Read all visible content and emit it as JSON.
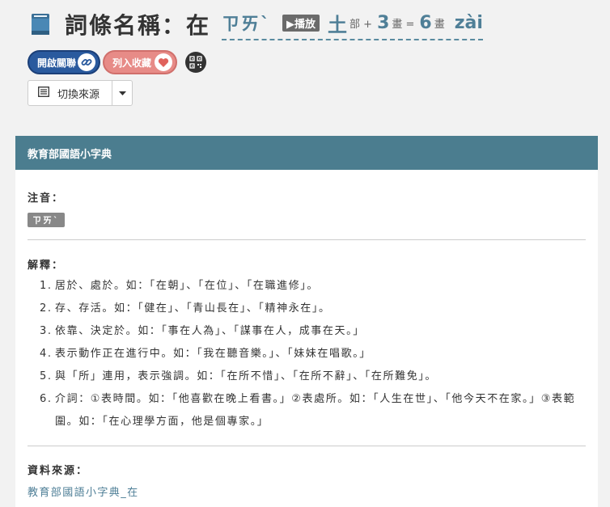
{
  "header": {
    "title": "詞條名稱：在",
    "zhuyin": "ㄗㄞˋ",
    "play_label": "▶播放",
    "radical": "土",
    "radical_suffix": "部 +",
    "extra_strokes": "3",
    "extra_strokes_suffix": "畫 =",
    "total_strokes": "6",
    "total_strokes_suffix": "畫",
    "pinyin": "zài"
  },
  "buttons": {
    "link_label": "開啟關聯",
    "fav_label": "列入收藏"
  },
  "switch_source": {
    "label": "切換來源"
  },
  "panel": {
    "title": "教育部國語小字典",
    "zhuyin_label": "注音：",
    "zhuyin_value": "ㄗㄞˋ",
    "def_label": "解釋：",
    "definitions": [
      {
        "num": "1.",
        "text": "居於、處於。如：「在朝」、「在位」、「在職進修」。"
      },
      {
        "num": "2.",
        "text": "存、存活。如：「健在」、「青山長在」、「精神永在」。"
      },
      {
        "num": "3.",
        "text": "依靠、決定於。如：「事在人為」、「謀事在人，成事在天。」"
      },
      {
        "num": "4.",
        "text": "表示動作正在進行中。如：「我在聽音樂。」、「妹妹在唱歌。」"
      },
      {
        "num": "5.",
        "text": "與「所」連用，表示強調。如：「在所不惜」、「在所不辭」、「在所難免」。"
      },
      {
        "num": "6.",
        "text": "介詞：①表時間。如：「他喜歡在晚上看書。」②表處所。如：「人生在世」、「他今天不在家。」③表範圍。如：「在心理學方面，他是個專家。」"
      }
    ],
    "source_label": "資料來源：",
    "source_link": "教育部國語小字典_在"
  },
  "colors": {
    "accent": "#4f7f97",
    "panel_header": "#4b7d8f",
    "link_pill": "#2a5a9e",
    "fav_pill": "#e78b87"
  }
}
